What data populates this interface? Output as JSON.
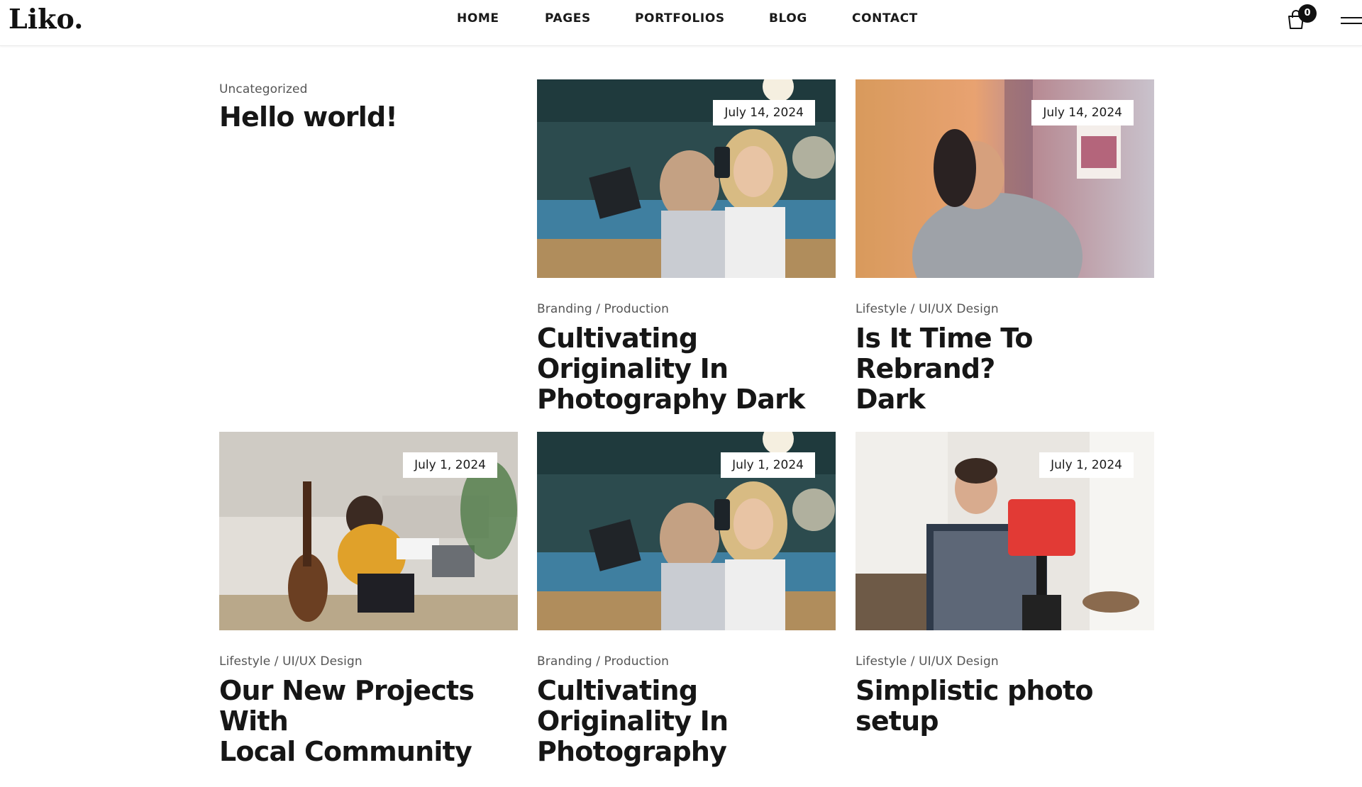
{
  "brand": {
    "logo": "Liko."
  },
  "nav": {
    "items": [
      {
        "label": "HOME"
      },
      {
        "label": "PAGES"
      },
      {
        "label": "PORTFOLIOS"
      },
      {
        "label": "BLOG"
      },
      {
        "label": "CONTACT"
      }
    ]
  },
  "cart": {
    "count": "0",
    "icon": "shopping-bag-icon"
  },
  "menu": {
    "icon": "hamburger-menu-icon"
  },
  "posts": [
    {
      "category": "Uncategorized",
      "title": "Hello world!"
    },
    {
      "date": "July 14, 2024",
      "category": "Branding / Production",
      "title": "Cultivating Originality In\n Photography Dark"
    },
    {
      "date": "July 14, 2024",
      "category": "Lifestyle / UI/UX Design",
      "title": "Is It Time To Rebrand?\nDark"
    },
    {
      "date": "July 1, 2024",
      "category": "Lifestyle / UI/UX Design",
      "title": "Our New Projects With\nLocal Community"
    },
    {
      "date": "July 1, 2024",
      "category": "Branding / Production",
      "title": "Cultivating Originality In\n Photography"
    },
    {
      "date": "July 1, 2024",
      "category": "Lifestyle / UI/UX Design",
      "title": "Simplistic photo setup"
    }
  ]
}
